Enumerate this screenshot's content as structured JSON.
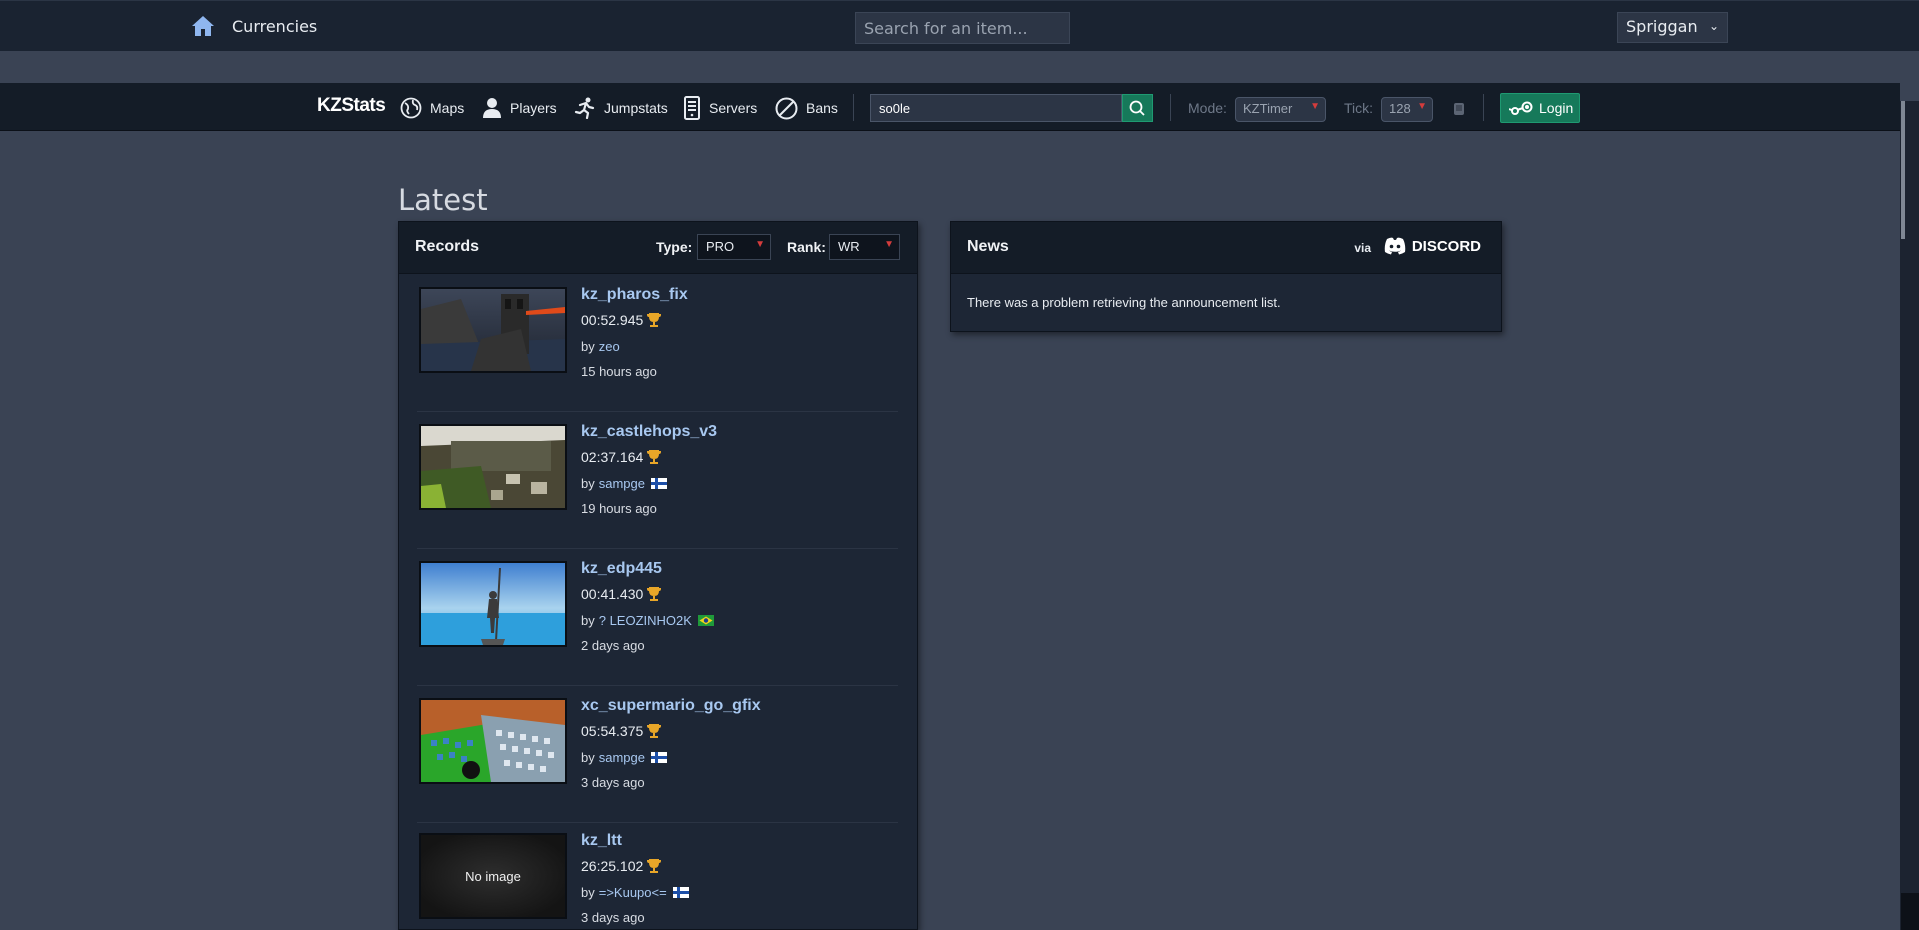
{
  "topbar": {
    "currencies_label": "Currencies",
    "search_placeholder": "Search for an item...",
    "league_selected": "Spriggan"
  },
  "nav": {
    "brand": "KZStats",
    "items": [
      {
        "label": "Maps",
        "icon": "globe-icon"
      },
      {
        "label": "Players",
        "icon": "person-icon"
      },
      {
        "label": "Jumpstats",
        "icon": "runner-icon"
      },
      {
        "label": "Servers",
        "icon": "server-icon"
      },
      {
        "label": "Bans",
        "icon": "ban-icon"
      }
    ],
    "search_value": "so0le",
    "mode_label": "Mode:",
    "mode_value": "KZTimer",
    "tick_label": "Tick:",
    "tick_value": "128",
    "login_label": "Login"
  },
  "page": {
    "heading": "Latest"
  },
  "records": {
    "title": "Records",
    "type_label": "Type:",
    "type_value": "PRO",
    "rank_label": "Rank:",
    "rank_value": "WR",
    "by_prefix": "by",
    "items": [
      {
        "map": "kz_pharos_fix",
        "time": "00:52.945",
        "player": "zeo",
        "flag": "",
        "ago": "15 hours ago",
        "has_image": true
      },
      {
        "map": "kz_castlehops_v3",
        "time": "02:37.164",
        "player": "sampge",
        "flag": "fi",
        "ago": "19 hours ago",
        "has_image": true
      },
      {
        "map": "kz_edp445",
        "time": "00:41.430",
        "player": "? LEOZINHO2K",
        "flag": "br",
        "ago": "2 days ago",
        "has_image": true
      },
      {
        "map": "xc_supermario_go_gfix",
        "time": "05:54.375",
        "player": "sampge",
        "flag": "fi",
        "ago": "3 days ago",
        "has_image": true
      },
      {
        "map": "kz_ltt",
        "time": "26:25.102",
        "player": "=>Kuupo<=",
        "flag": "fi",
        "ago": "3 days ago",
        "has_image": false,
        "no_image_text": "No image"
      }
    ]
  },
  "news": {
    "title": "News",
    "via": "via",
    "discord": "DISCORD",
    "message": "There was a problem retrieving the announcement list."
  },
  "colors": {
    "background": "#3a4354",
    "nav": "#141c27",
    "accent_green": "#16795a",
    "link": "#a8c8f0",
    "trophy": "#e8a628"
  }
}
